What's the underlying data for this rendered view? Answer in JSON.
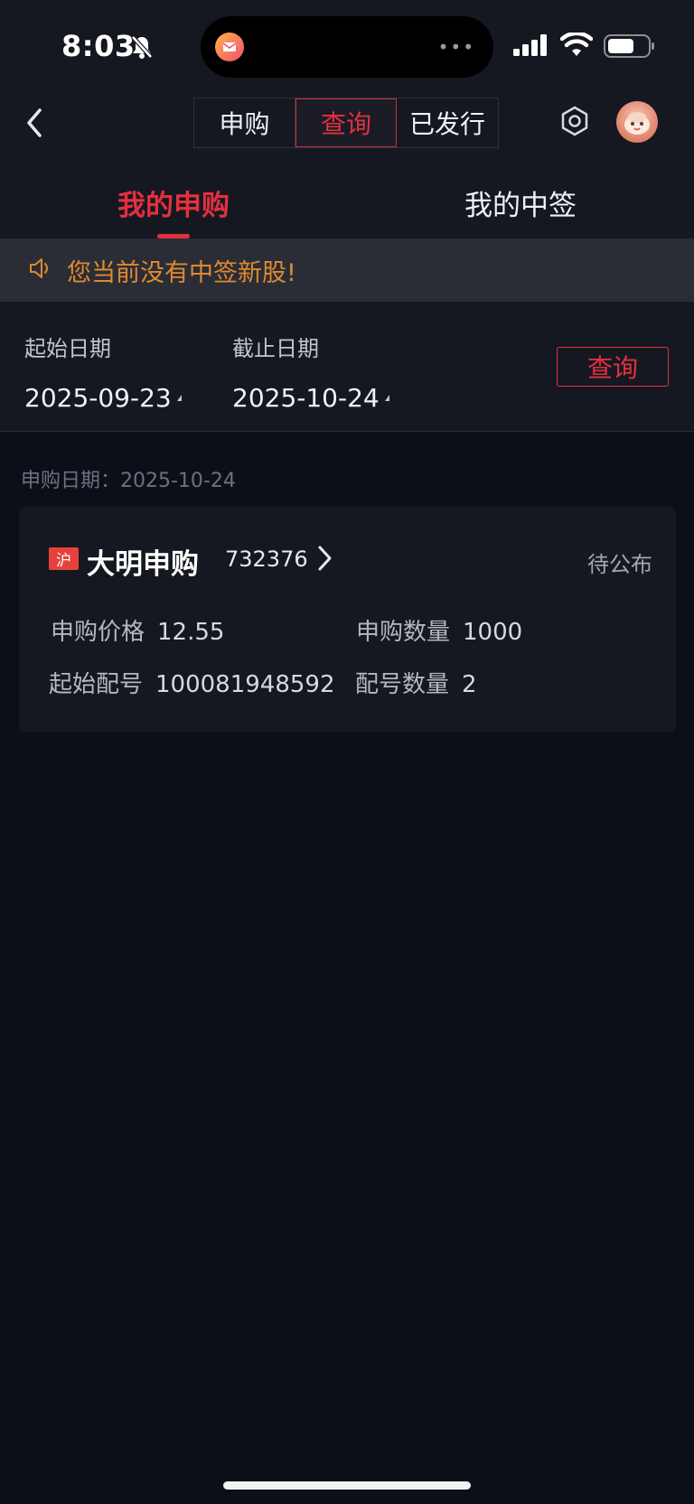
{
  "status_bar": {
    "time": "8:03",
    "icons": [
      "bell-slash-icon",
      "mail-app-icon",
      "signal-icon",
      "wifi-icon",
      "battery-icon"
    ],
    "island_dots": "•••"
  },
  "header": {
    "back_icon": "chevron-left-icon",
    "segments": [
      "申购",
      "查询",
      "已发行"
    ],
    "active_segment": "查询",
    "settings_icon": "hexagon-settings-icon",
    "avatar_icon": "avatar"
  },
  "tabs": [
    "我的申购",
    "我的中签"
  ],
  "notice": {
    "icon": "speaker-icon",
    "text": "您当前没有中签新股!"
  },
  "filter": {
    "start_label": "起始日期",
    "start_value": "2025-09-23",
    "end_label": "截止日期",
    "end_value": "2025-10-24",
    "query_label": "查询"
  },
  "list": {
    "group_date": "申购日期：2025-10-24",
    "items": [
      {
        "market": "沪",
        "name": "大明申购",
        "code": "732376",
        "status": "待公布",
        "price_label": "申购价格",
        "price": "12.55",
        "qty_label": "申购数量",
        "qty": "1000",
        "start_no_label": "起始配号",
        "start_no": "100081948592",
        "no_count_label": "配号数量",
        "no_count": "2"
      }
    ]
  },
  "colors": {
    "accent_red": "#e3303e",
    "notice_orange": "#e08a2e",
    "background": "#0d0f18",
    "panel": "#151821"
  }
}
